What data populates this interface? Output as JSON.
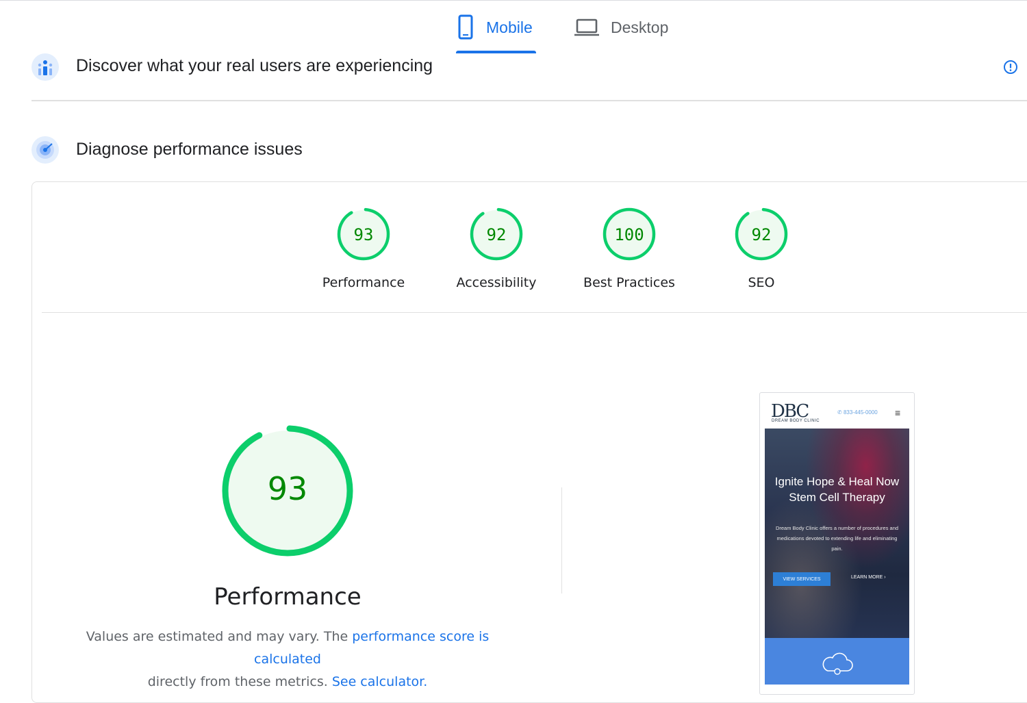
{
  "tabs": {
    "mobile": {
      "label": "Mobile",
      "active": true
    },
    "desktop": {
      "label": "Desktop",
      "active": false
    }
  },
  "sections": {
    "crux_title": "Discover what your real users are experiencing",
    "lighthouse_title": "Diagnose performance issues"
  },
  "scores": [
    {
      "label": "Performance",
      "value": "93",
      "score": 93
    },
    {
      "label": "Accessibility",
      "value": "92",
      "score": 92
    },
    {
      "label": "Best Practices",
      "value": "100",
      "score": 100
    },
    {
      "label": "SEO",
      "value": "92",
      "score": 92
    }
  ],
  "main_gauge": {
    "value": "93",
    "score": 93,
    "label": "Performance"
  },
  "description": {
    "text1": "Values are estimated and may vary. The ",
    "link1": "performance score is calculated",
    "text2": "directly from these metrics. ",
    "link2": "See calculator."
  },
  "screenshot": {
    "logo": "DBC",
    "logo_sub": "DREAM BODY CLINIC",
    "phone": "833-445-0000",
    "headline": "Ignite Hope & Heal Now Stem Cell Therapy",
    "body": "Dream Body Clinic offers a number of procedures and medications devoted to extending life and eliminating pain.",
    "button_primary": "VIEW SERVICES",
    "button_secondary": "LEARN MORE ›"
  },
  "colors": {
    "accent": "#1a73e8",
    "pass_green": "#0cce6b",
    "pass_text": "#008800",
    "pass_fill": "#eefaf0"
  },
  "icons": {
    "mobile_tab": "smartphone-icon",
    "desktop_tab": "laptop-icon",
    "crux": "users-chart-icon",
    "lighthouse": "radar-icon",
    "info": "info-icon"
  }
}
